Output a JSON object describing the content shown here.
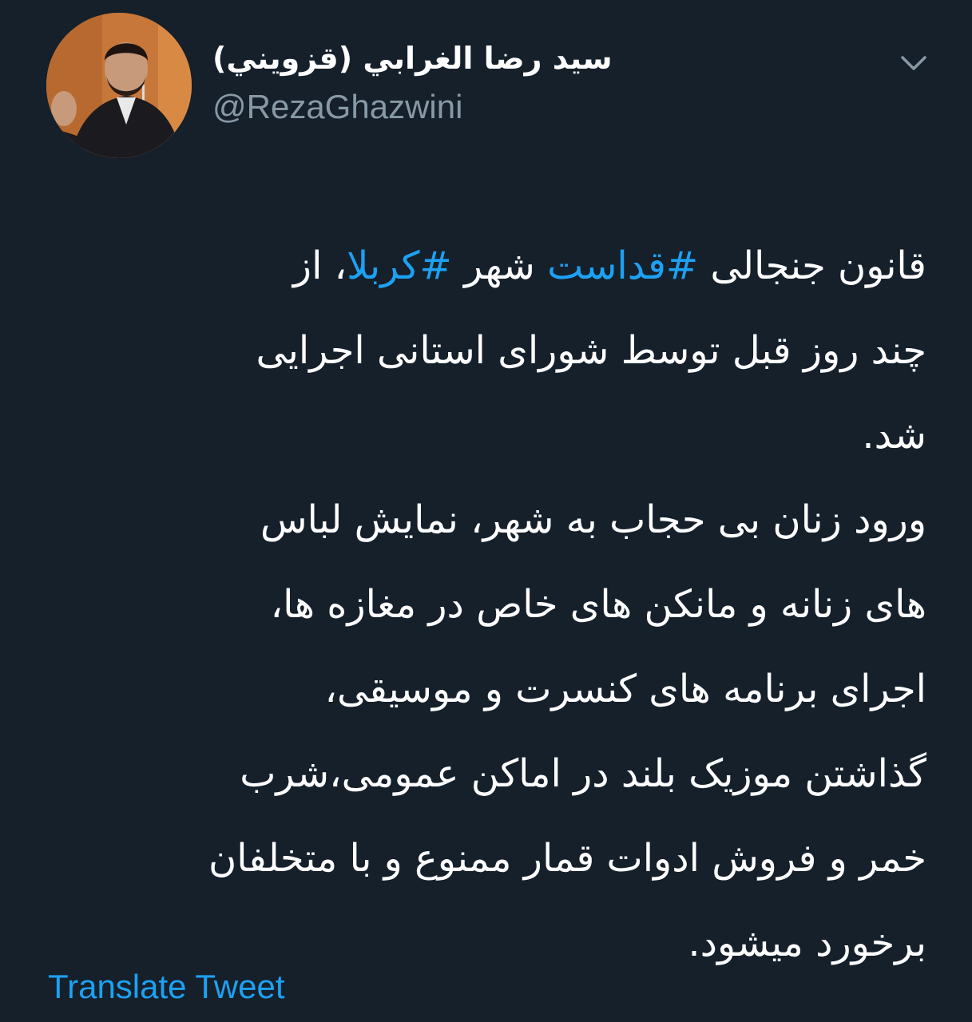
{
  "author": {
    "display_name": "سيد رضا الغرابي (قزويني)",
    "handle": "@RezaGhazwini",
    "avatar_icon": "profile-photo"
  },
  "menu": {
    "icon": "chevron-down-icon"
  },
  "tweet": {
    "line1": {
      "part1": "قانون جنجالی ",
      "hashtag1": "#قداست",
      "part2": " شهر ",
      "hashtag2": "#کربلا",
      "part3": "، از"
    },
    "lines": [
      "چند روز قبل توسط شورای استانی اجرایی",
      "شد.",
      "ورود زنان بی حجاب به شهر، نمایش لباس",
      "های زنانه و مانکن های خاص در مغازه ها،",
      "اجرای برنامه های کنسرت و موسیقی،",
      "گذاشتن موزیک بلند در اماکن عمومی،شرب",
      "خمر و فروش ادوات قمار ممنوع و با متخلفان",
      "برخورد میشود."
    ]
  },
  "translate_label": "Translate Tweet",
  "colors": {
    "background": "#15202b",
    "text": "#ffffff",
    "secondary_text": "#8899a6",
    "accent": "#1da1f2"
  }
}
